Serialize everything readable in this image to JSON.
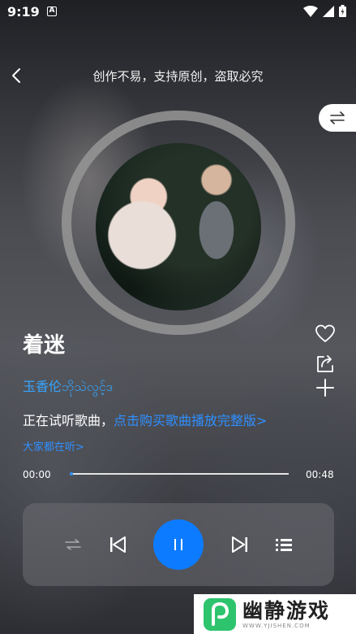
{
  "status_bar": {
    "time": "9:19",
    "notification_badge": "A"
  },
  "header": {
    "title": "创作不易，支持原创，盗取必究"
  },
  "song": {
    "title": "着迷",
    "artist": "玉香伦ဘိုသဲလွင့်ဒ",
    "trial_prefix": "正在试听歌曲，",
    "trial_link": "点击购买歌曲播放完整版>",
    "listen_link": "大家都在听>"
  },
  "progress": {
    "current": "00:00",
    "total": "00:48",
    "fraction": 0.01
  },
  "colors": {
    "accent": "#0d7bff",
    "link": "#2f8fff"
  },
  "watermark": {
    "name": "幽静游戏",
    "url": "WWW.YJISHEN.COM"
  },
  "icons": [
    "back-icon",
    "switch-icon",
    "heart-icon",
    "share-icon",
    "add-icon",
    "shuffle-icon",
    "previous-icon",
    "pause-icon",
    "next-icon",
    "playlist-icon"
  ]
}
